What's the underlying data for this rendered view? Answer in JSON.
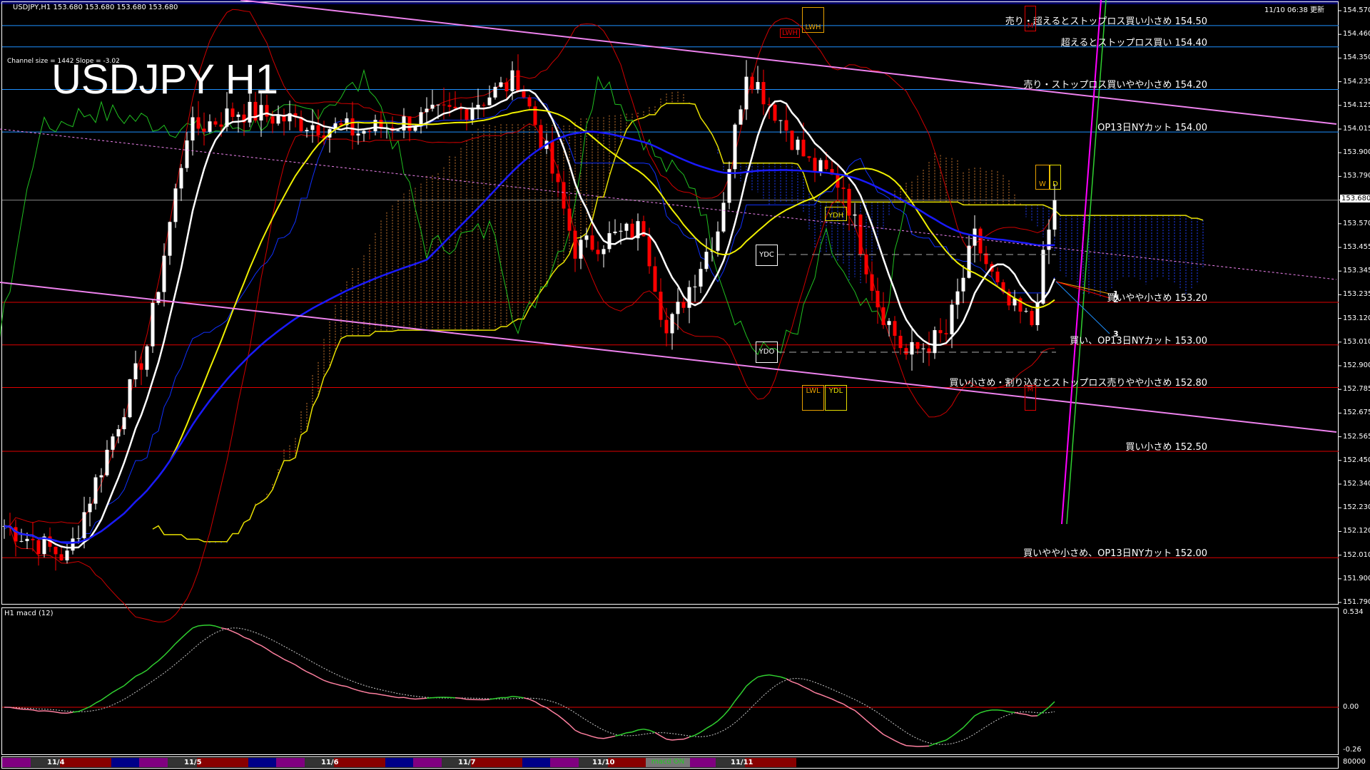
{
  "header": {
    "symbol_info": "USDJPY,H1  153.680 153.680 153.680 153.680",
    "updated": "11/10 06:38 更新",
    "channel_info": "Channel size = 1442 Slope = -3.02",
    "big_title": "USDJPY H1"
  },
  "levels": [
    {
      "price": 154.5,
      "label": "売り・超えるとストップロス買い小さめ 154.50",
      "color": "#1e90ff"
    },
    {
      "price": 154.4,
      "label": "超えるとストップロス買い 154.40",
      "color": "#1e90ff"
    },
    {
      "price": 154.2,
      "label": "売り・ストップロス買いやや小さめ 154.20",
      "color": "#1e90ff"
    },
    {
      "price": 154.0,
      "label": "OP13日NYカット 154.00",
      "color": "#1e90ff"
    },
    {
      "price": 153.2,
      "label": "買いやや小さめ 153.20",
      "color": "#e00000"
    },
    {
      "price": 153.0,
      "label": "買い、OP13日NYカット 153.00",
      "color": "#e00000"
    },
    {
      "price": 152.8,
      "label": "買い小さめ・割り込むとストップロス売りやや小さめ 152.80",
      "color": "#e00000"
    },
    {
      "price": 152.5,
      "label": "買い小さめ 152.50",
      "color": "#e00000"
    },
    {
      "price": 152.0,
      "label": "買いやや小さめ、OP13日NYカット 152.00",
      "color": "#e00000"
    }
  ],
  "price_axis": [
    "154.570",
    "154.460",
    "154.350",
    "154.235",
    "154.125",
    "154.015",
    "153.900",
    "153.790",
    "153.680",
    "153.570",
    "153.455",
    "153.345",
    "153.235",
    "153.120",
    "153.010",
    "152.900",
    "152.785",
    "152.675",
    "152.565",
    "152.450",
    "152.340",
    "152.230",
    "152.120",
    "152.010",
    "151.900",
    "151.790"
  ],
  "current_price": "153.680",
  "markers": {
    "lwh": "LWH",
    "lwh_red": "LWH",
    "ydh": "YDH",
    "ydc": "YDC",
    "ydo": "YDO",
    "lwl": "LWL",
    "ydl": "YDL",
    "w": "W",
    "d": "D",
    "m": "M"
  },
  "fib_labels": [
    "1",
    "2",
    "3"
  ],
  "macd": {
    "title": "H1  macd (12)",
    "axis": [
      "0.534",
      "0.00",
      "-0.26"
    ],
    "volume_axis": "80000"
  },
  "date_bar": {
    "dates": [
      "11/4",
      "11/5",
      "11/6",
      "11/7",
      "11/10",
      "11/11"
    ],
    "macd_button": "macd ON"
  },
  "chart_data": {
    "type": "candlestick",
    "symbol": "USDJPY",
    "timeframe": "H1",
    "ylim": [
      151.79,
      154.57
    ],
    "waypoints_bar": [
      0,
      11,
      25,
      32,
      41,
      62,
      80,
      90,
      95,
      100,
      112,
      116,
      125,
      130,
      135,
      141,
      147,
      153,
      158,
      165,
      170,
      175,
      180,
      184
    ],
    "waypoints_price": [
      152.15,
      152.0,
      153.0,
      154.0,
      154.1,
      154.0,
      154.1,
      154.25,
      153.9,
      153.45,
      153.55,
      153.05,
      153.55,
      154.3,
      154.1,
      153.85,
      153.75,
      153.2,
      152.95,
      153.05,
      153.5,
      153.2,
      153.1,
      153.68
    ]
  }
}
